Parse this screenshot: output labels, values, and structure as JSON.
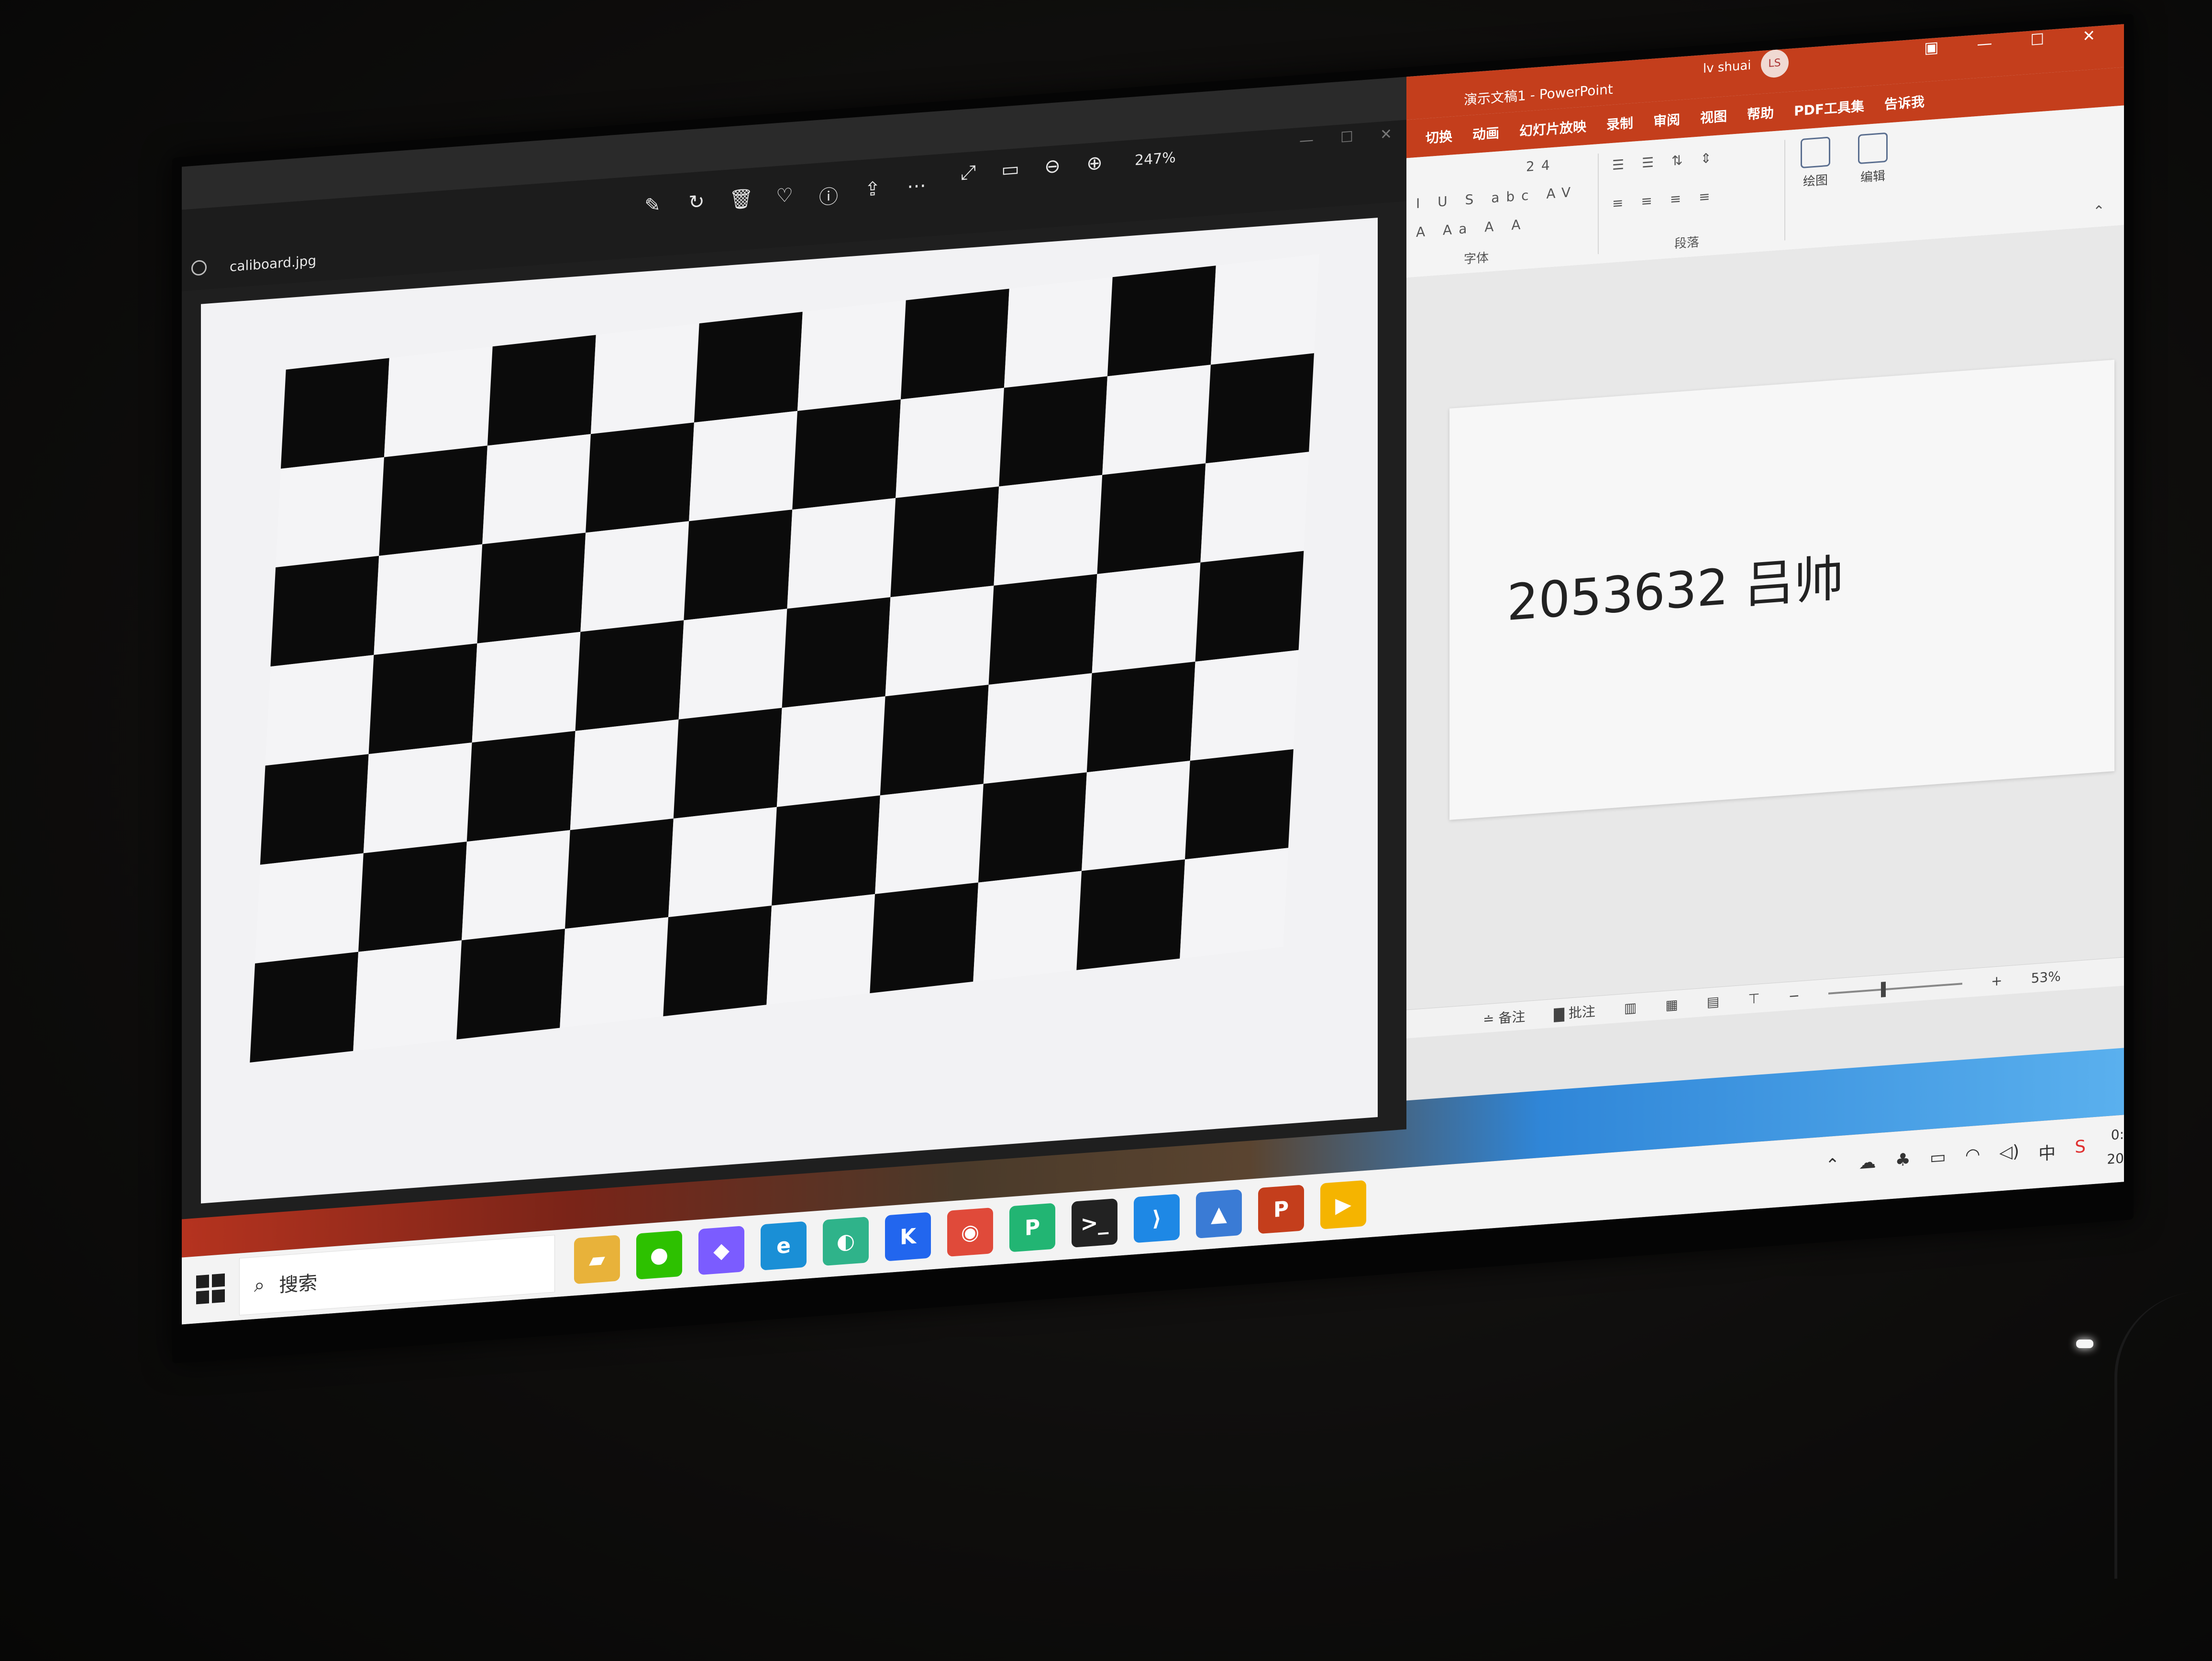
{
  "photos": {
    "filename": "caliboard.jpg",
    "zoom": "247%",
    "toolbar_icons": [
      "edit-icon",
      "rotate-icon",
      "delete-icon",
      "favorite-icon",
      "info-icon",
      "share-icon",
      "more-icon"
    ],
    "view_icons": [
      "fullscreen-icon",
      "fit-icon",
      "zoom-out-icon",
      "zoom-in-icon"
    ],
    "board": {
      "cols": 10,
      "rows": 7
    }
  },
  "powerpoint": {
    "title": "演示文稿1 - PowerPoint",
    "user": "lv shuai",
    "avatar": "LS",
    "tabs": [
      "切换",
      "动画",
      "幻灯片放映",
      "录制",
      "审阅",
      "视图",
      "帮助",
      "PDF工具集",
      "告诉我"
    ],
    "ribbon": {
      "font_size": "24",
      "group_font": "字体",
      "group_paragraph": "段落",
      "draw": "绘图",
      "edit": "编辑"
    },
    "slide_text": "2053632 吕帅",
    "status": {
      "notes": "备注",
      "comments": "批注",
      "zoom": "53%"
    }
  },
  "taskbar": {
    "search_placeholder": "搜索",
    "apps": [
      {
        "name": "file-explorer-icon",
        "glyph": "▰",
        "color": "#e8b23a"
      },
      {
        "name": "wechat-icon",
        "glyph": "●",
        "color": "#2dc100"
      },
      {
        "name": "copilot-icon",
        "glyph": "◆",
        "color": "#7b5cff"
      },
      {
        "name": "edge-icon",
        "glyph": "e",
        "color": "#1a8fd6"
      },
      {
        "name": "app-green-icon",
        "glyph": "◐",
        "color": "#2fb38a"
      },
      {
        "name": "kuake-icon",
        "glyph": "K",
        "color": "#2266ee"
      },
      {
        "name": "chrome-icon",
        "glyph": "◉",
        "color": "#e04a3a"
      },
      {
        "name": "pdf-icon",
        "glyph": "P",
        "color": "#22b573"
      },
      {
        "name": "terminal-icon",
        "glyph": ">_",
        "color": "#222222"
      },
      {
        "name": "vscode-icon",
        "glyph": "⟩",
        "color": "#1e88e5"
      },
      {
        "name": "photos-icon",
        "glyph": "▲",
        "color": "#3a7bd5"
      },
      {
        "name": "powerpoint-icon",
        "glyph": "P",
        "color": "#c43e1c"
      },
      {
        "name": "video-app-icon",
        "glyph": "▶",
        "color": "#f5b400"
      }
    ],
    "ime": "中",
    "clock_line1": "0:",
    "clock_line2": "20"
  }
}
